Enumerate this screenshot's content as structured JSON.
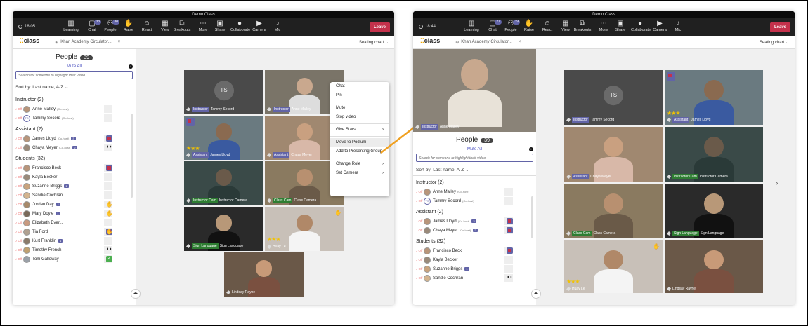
{
  "left": {
    "window_title": "Demo Class",
    "time": "18:05",
    "toolbar": [
      {
        "label": "Learning",
        "icon": "bars-icon",
        "badge": ""
      },
      {
        "label": "Chat",
        "icon": "chat-icon",
        "badge": "33"
      },
      {
        "label": "People",
        "icon": "people-icon",
        "badge": "38"
      },
      {
        "label": "Raise",
        "icon": "hand-icon",
        "badge": ""
      },
      {
        "label": "React",
        "icon": "smile-icon",
        "badge": ""
      },
      {
        "label": "View",
        "icon": "grid-icon",
        "badge": ""
      },
      {
        "label": "Breakouts",
        "icon": "breakout-icon",
        "badge": ""
      },
      {
        "label": "More",
        "icon": "more-icon",
        "badge": ""
      },
      {
        "label": "Share",
        "icon": "share-icon",
        "badge": ""
      },
      {
        "label": "Collaborate",
        "icon": "bulb-icon",
        "badge": ""
      },
      {
        "label": "Camera",
        "icon": "camera-icon",
        "badge": ""
      },
      {
        "label": "Mic",
        "icon": "mic-icon",
        "badge": ""
      }
    ],
    "leave": "Leave",
    "app_logo": "class",
    "tab_title": "Khan Academy Circulator...",
    "seating": "Seating chart",
    "people_title": "People",
    "people_count": "39",
    "mute_all": "Mute All",
    "search_placeholder": "Search for someone to highlight their video",
    "sort": "Sort by: Last name, A-Z",
    "groups": [
      {
        "title": "Instructor (2)",
        "people": [
          {
            "name": "Anne Malley",
            "cohost": "(Co-host)"
          },
          {
            "name": "Tammy Secord",
            "cohost": "(Co-host)",
            "initials": "TS"
          }
        ]
      },
      {
        "title": "Assistant (2)",
        "people": [
          {
            "name": "James Lloyd",
            "cohost": "(Co-host)",
            "star": "3"
          },
          {
            "name": "Chaya Meyer",
            "cohost": "(Co-host)",
            "star": "2"
          }
        ]
      },
      {
        "title": "Students (32)",
        "people": [
          {
            "name": "Francisco Beck"
          },
          {
            "name": "Kayla Becker"
          },
          {
            "name": "Suzanne Briggs",
            "star": "1"
          },
          {
            "name": "Sandie Cochran"
          },
          {
            "name": "Jordan Day",
            "star": "1"
          },
          {
            "name": "Mary Doyle",
            "star": "1"
          },
          {
            "name": "Elizabeth Ever..."
          },
          {
            "name": "Tia Ford"
          },
          {
            "name": "Kurt Franklin",
            "star": "1"
          },
          {
            "name": "Timothy French"
          },
          {
            "name": "Tom Galloway"
          }
        ]
      }
    ],
    "tiles": [
      {
        "role": "Instructor",
        "name": "Tammy Secord",
        "initials": "TS"
      },
      {
        "role": "Instructor",
        "name": "Anne Malley"
      },
      {
        "role": "Assistant",
        "name": "James Lloyd"
      },
      {
        "role": "Assistant",
        "name": "Chaya Meyer"
      },
      {
        "role": "Instructor Cam",
        "name": "Instructor Camera"
      },
      {
        "role": "Class Cam",
        "name": "Class Camera"
      },
      {
        "role": "Sign Language",
        "name": "Sign Language"
      },
      {
        "role": "",
        "name": "Huay Le"
      },
      {
        "role": "",
        "name": "Lindsay Rayne"
      }
    ],
    "menu": [
      "Chat",
      "Pin",
      "Mute",
      "Stop video",
      "Give Stars",
      "Move to Podium",
      "Add to Presenting Group",
      "Change Role",
      "Set Camera"
    ],
    "more_dots": "..."
  },
  "right": {
    "window_title": "Demo Class",
    "time": "18:44",
    "toolbar": [
      {
        "label": "Learning",
        "icon": "bars-icon",
        "badge": ""
      },
      {
        "label": "Chat",
        "icon": "chat-icon",
        "badge": "21"
      },
      {
        "label": "People",
        "icon": "people-icon",
        "badge": "39"
      },
      {
        "label": "Raise",
        "icon": "hand-icon",
        "badge": ""
      },
      {
        "label": "React",
        "icon": "smile-icon",
        "badge": ""
      },
      {
        "label": "View",
        "icon": "grid-icon",
        "badge": ""
      },
      {
        "label": "Breakouts",
        "icon": "breakout-icon",
        "badge": ""
      },
      {
        "label": "More",
        "icon": "more-icon",
        "badge": ""
      },
      {
        "label": "Share",
        "icon": "share-icon",
        "badge": ""
      },
      {
        "label": "Collaborate",
        "icon": "bulb-icon",
        "badge": ""
      },
      {
        "label": "Camera",
        "icon": "camera-icon",
        "badge": ""
      },
      {
        "label": "Mic",
        "icon": "mic-icon",
        "badge": ""
      }
    ],
    "leave": "Leave",
    "app_logo": "class",
    "tab_title": "Khan Academy Circulator...",
    "seating": "Seating chart",
    "podium_role": "Instructor",
    "podium_name": "Anne Malley",
    "people_title": "People",
    "people_count": "39",
    "mute_all": "Mute All",
    "search_placeholder": "Search for someone to highlight their video",
    "sort": "Sort by: Last name, A-Z",
    "groups": [
      {
        "title": "Instructor (2)",
        "people": [
          {
            "name": "Anne Malley",
            "cohost": "(Co-host)"
          },
          {
            "name": "Tammy Secord",
            "cohost": "(Co-host)",
            "initials": "TS"
          }
        ]
      },
      {
        "title": "Assistant (2)",
        "people": [
          {
            "name": "James Lloyd",
            "cohost": "(Co-host)",
            "star": "3"
          },
          {
            "name": "Chaya Meyer",
            "cohost": "(Co-host)",
            "star": "2"
          }
        ]
      },
      {
        "title": "Students (32)",
        "people": [
          {
            "name": "Francisco Beck"
          },
          {
            "name": "Kayla Becker"
          },
          {
            "name": "Suzanne Briggs",
            "star": "1"
          },
          {
            "name": "Sandie Cochran"
          }
        ]
      }
    ],
    "tiles": [
      {
        "role": "Instructor",
        "name": "Tammy Secord",
        "initials": "TS"
      },
      {
        "role": "Assistant",
        "name": "James Lloyd"
      },
      {
        "role": "Assistant",
        "name": "Chaya Meyer"
      },
      {
        "role": "Instructor Cam",
        "name": "Instructor Camera"
      },
      {
        "role": "Class Cam",
        "name": "Class Camera"
      },
      {
        "role": "Sign Language",
        "name": "Sign Language"
      },
      {
        "role": "",
        "name": "Huay Le"
      },
      {
        "role": "",
        "name": "Lindsay Rayne"
      }
    ]
  }
}
